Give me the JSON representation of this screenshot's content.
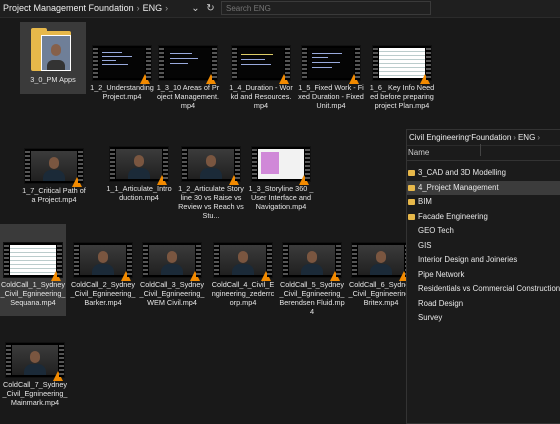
{
  "explorer": {
    "breadcrumb": [
      "Project Management Foundation",
      "ENG"
    ],
    "search_placeholder": "Search ENG",
    "items": [
      {
        "label": "3_0_PM Apps",
        "kind": "folder"
      },
      {
        "label": "1_2_Understanding Project.mp4",
        "kind": "video",
        "screen": "code"
      },
      {
        "label": "1_3_10 Areas of Project Management.mp4",
        "kind": "video",
        "screen": "code"
      },
      {
        "label": "1_4_Duration - Workd and Resources.mp4",
        "kind": "video",
        "screen": "code"
      },
      {
        "label": "1_5_Fixed Work - Fixed Duration - Fixed Unit.mp4",
        "kind": "video",
        "screen": "code"
      },
      {
        "label": "1_6_ Key Info Needed before preparing project Plan.mp4",
        "kind": "video",
        "screen": "code"
      },
      {
        "label": "1_7_Critical Path of a Project.mp4",
        "kind": "video",
        "screen": "person"
      },
      {
        "label": "1_1_Articulate_Introduction.mp4",
        "kind": "video",
        "screen": "person"
      },
      {
        "label": "1_2_Articulate Storyline 30 vs Raise vs Review vs Reach vs Stu...",
        "kind": "video",
        "screen": "person"
      },
      {
        "label": "1_3_Storyline 360 _ User Interface and Navigation.mp4",
        "kind": "video",
        "screen": "doc"
      },
      {
        "label": "ColdCall_1_Sydney_Civil_Egnineering_Sequana.mp4",
        "kind": "video",
        "screen": "sheet"
      },
      {
        "label": "ColdCall_2_Sydney_Civil_Egnineering_Barker.mp4",
        "kind": "video",
        "screen": "person"
      },
      {
        "label": "ColdCall_3_Sydney_Civil_Egnineering_WEM Civil.mp4",
        "kind": "video",
        "screen": "person"
      },
      {
        "label": "ColdCall_4_Civil_Engineering_zederrcorp.mp4",
        "kind": "video",
        "screen": "person"
      },
      {
        "label": "ColdCall_5_Sydney_Civil_Egnineering_Berendsen Fluid.mp4",
        "kind": "video",
        "screen": "person"
      },
      {
        "label": "ColdCall_6_Sydney_Civil_Egnineering_Britex.mp4",
        "kind": "video",
        "screen": "person"
      },
      {
        "label": "ColdCall_7_Sydney_Civil_Egnineering_Mainmark.mp4",
        "kind": "video",
        "screen": "person"
      }
    ]
  },
  "second_window": {
    "breadcrumb": [
      "Civil Engineering Foundation",
      "ENG"
    ],
    "column_header": "Name",
    "rows": [
      {
        "label": "3_CAD and 3D Modelling",
        "folder": true
      },
      {
        "label": "4_Project Management",
        "folder": true,
        "selected": true
      },
      {
        "label": "BIM",
        "folder": true
      },
      {
        "label": "Facade Engineering",
        "folder": true
      },
      {
        "label": "GEO Tech",
        "folder": false
      },
      {
        "label": "GIS",
        "folder": false
      },
      {
        "label": "Interior Design and Joineries",
        "folder": false
      },
      {
        "label": "Pipe Network",
        "folder": false
      },
      {
        "label": "Residentials vs Commercial Construction",
        "folder": false
      },
      {
        "label": "Road Design",
        "folder": false
      },
      {
        "label": "Survey",
        "folder": false
      }
    ]
  }
}
